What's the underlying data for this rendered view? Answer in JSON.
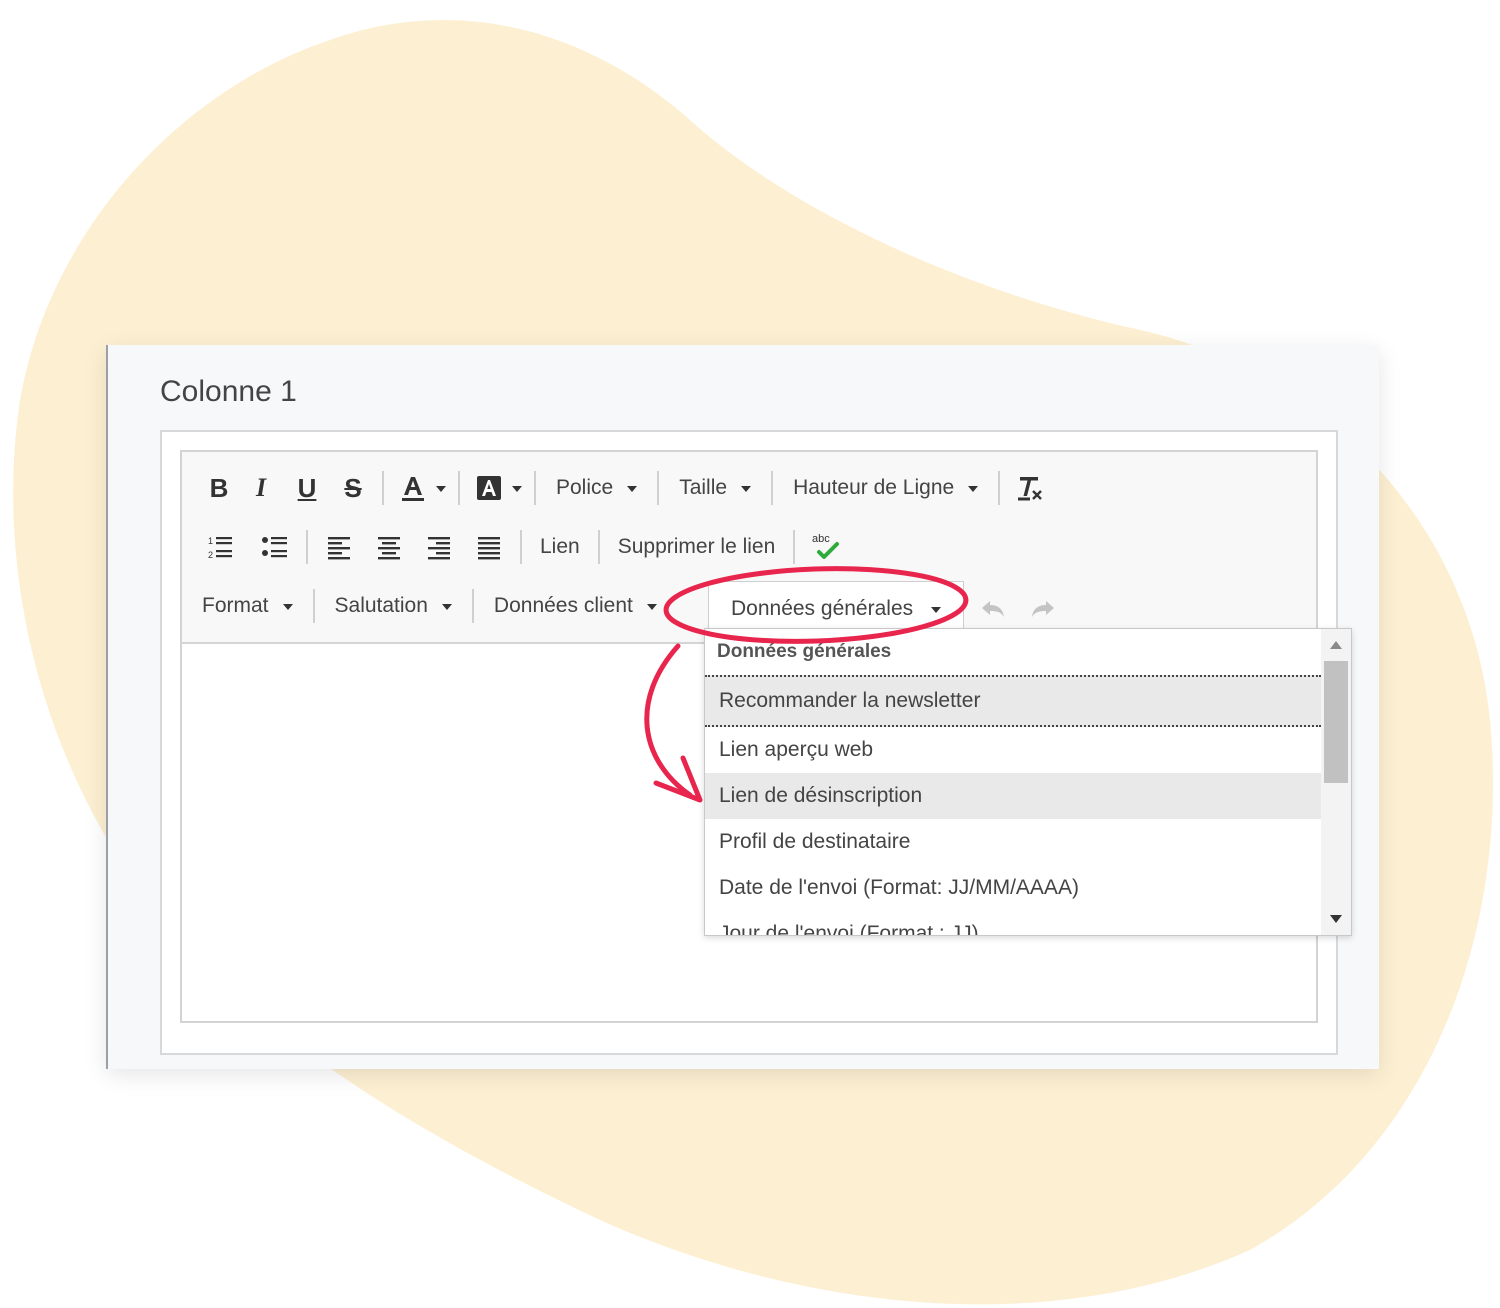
{
  "panel": {
    "title": "Colonne 1"
  },
  "toolbar": {
    "row1": {
      "bold": "B",
      "italic": "I",
      "underline": "U",
      "strike": "S",
      "font_label": "Police",
      "size_label": "Taille",
      "line_height_label": "Hauteur de Ligne"
    },
    "row2": {
      "link_label": "Lien",
      "unlink_label": "Supprimer le lien",
      "spellcheck_text": "abc"
    },
    "row3": {
      "format_label": "Format",
      "salutation_label": "Salutation",
      "client_data_label": "Données client",
      "general_data_label": "Données générales"
    }
  },
  "dropdown": {
    "header": "Données générales",
    "items": [
      "Recommander la newsletter",
      "Lien aperçu web",
      "Lien de désinscription",
      "Profil de destinataire",
      "Date de l'envoi (Format: JJ/MM/AAAA)",
      "Jour de l'envoi (Format : JJ)"
    ]
  },
  "colors": {
    "background_blob": "#fdf0d2",
    "annotation": "#e8254d"
  },
  "icons": [
    "text-color-icon",
    "background-color-icon",
    "remove-format-icon",
    "numbered-list-icon",
    "bulleted-list-icon",
    "align-left-icon",
    "align-center-icon",
    "align-right-icon",
    "justify-icon",
    "spellcheck-icon",
    "undo-icon",
    "redo-icon"
  ]
}
